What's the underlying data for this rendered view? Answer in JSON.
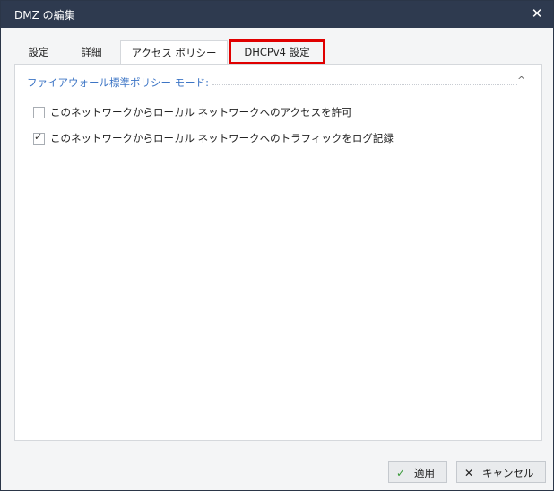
{
  "window": {
    "title": "DMZ の編集",
    "close_glyph": "✕"
  },
  "tabs": [
    {
      "label": "設定"
    },
    {
      "label": "詳細"
    },
    {
      "label": "アクセス ポリシー"
    },
    {
      "label": "DHCPv4 設定"
    }
  ],
  "section": {
    "title": "ファイアウォール標準ポリシー モード:",
    "collapse_glyph": "^",
    "options": [
      {
        "label": "このネットワークからローカル ネットワークへのアクセスを許可",
        "checked": false,
        "mark": ""
      },
      {
        "label": "このネットワークからローカル ネットワークへのトラフィックをログ記録",
        "checked": true,
        "mark": "✓"
      }
    ]
  },
  "buttons": {
    "apply": {
      "label": "適用",
      "icon": "✓"
    },
    "cancel": {
      "label": "キャンセル",
      "icon": "✕"
    }
  },
  "colors": {
    "titlebar": "#2e3a4f",
    "accent": "#3d75c5",
    "highlight": "#e00000"
  }
}
